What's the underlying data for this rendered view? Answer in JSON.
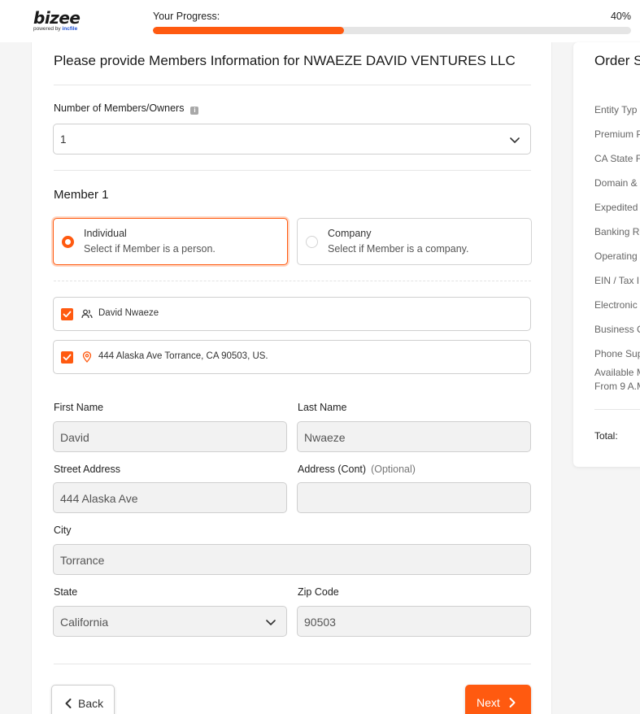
{
  "header": {
    "logo_text": "bizee",
    "logo_powered": "powered by",
    "logo_brand": "incfile",
    "progress_label": "Your Progress:",
    "progress_percent_text": "40%",
    "progress_value": 0.4,
    "accent_color": "#ff5a10"
  },
  "form": {
    "title": "Please provide Members Information for NWAEZE DAVID VENTURES LLC",
    "members_label": "Number of Members/Owners",
    "members_value": "1",
    "member_heading": "Member 1",
    "types": [
      {
        "title": "Individual",
        "desc": "Select if Member is a person.",
        "selected": true
      },
      {
        "title": "Company",
        "desc": "Select if Member is a company.",
        "selected": false
      }
    ],
    "checks": {
      "name": "David Nwaeze",
      "address": "444 Alaska Ave Torrance, CA 90503, US."
    },
    "fields": {
      "first_name_label": "First Name",
      "first_name_value": "David",
      "last_name_label": "Last Name",
      "last_name_value": "Nwaeze",
      "street_label": "Street Address",
      "street_value": "444 Alaska Ave",
      "address_cont_label": "Address (Cont)",
      "address_cont_optional": "(Optional)",
      "address_cont_value": "",
      "city_label": "City",
      "city_value": "Torrance",
      "state_label": "State",
      "state_value": "California",
      "zip_label": "Zip Code",
      "zip_value": "90503"
    },
    "back_label": "Back",
    "next_label": "Next"
  },
  "summary": {
    "title": "Order S",
    "items": [
      "Entity Typ",
      "Premium P",
      "CA State F",
      "Domain & I",
      "Expedited",
      "Banking Re",
      "Operating",
      "EIN / Tax ID",
      "Electronic",
      "Business C",
      "Phone Sup",
      "Available M",
      "From 9 A.M"
    ],
    "total_label": "Total:"
  }
}
